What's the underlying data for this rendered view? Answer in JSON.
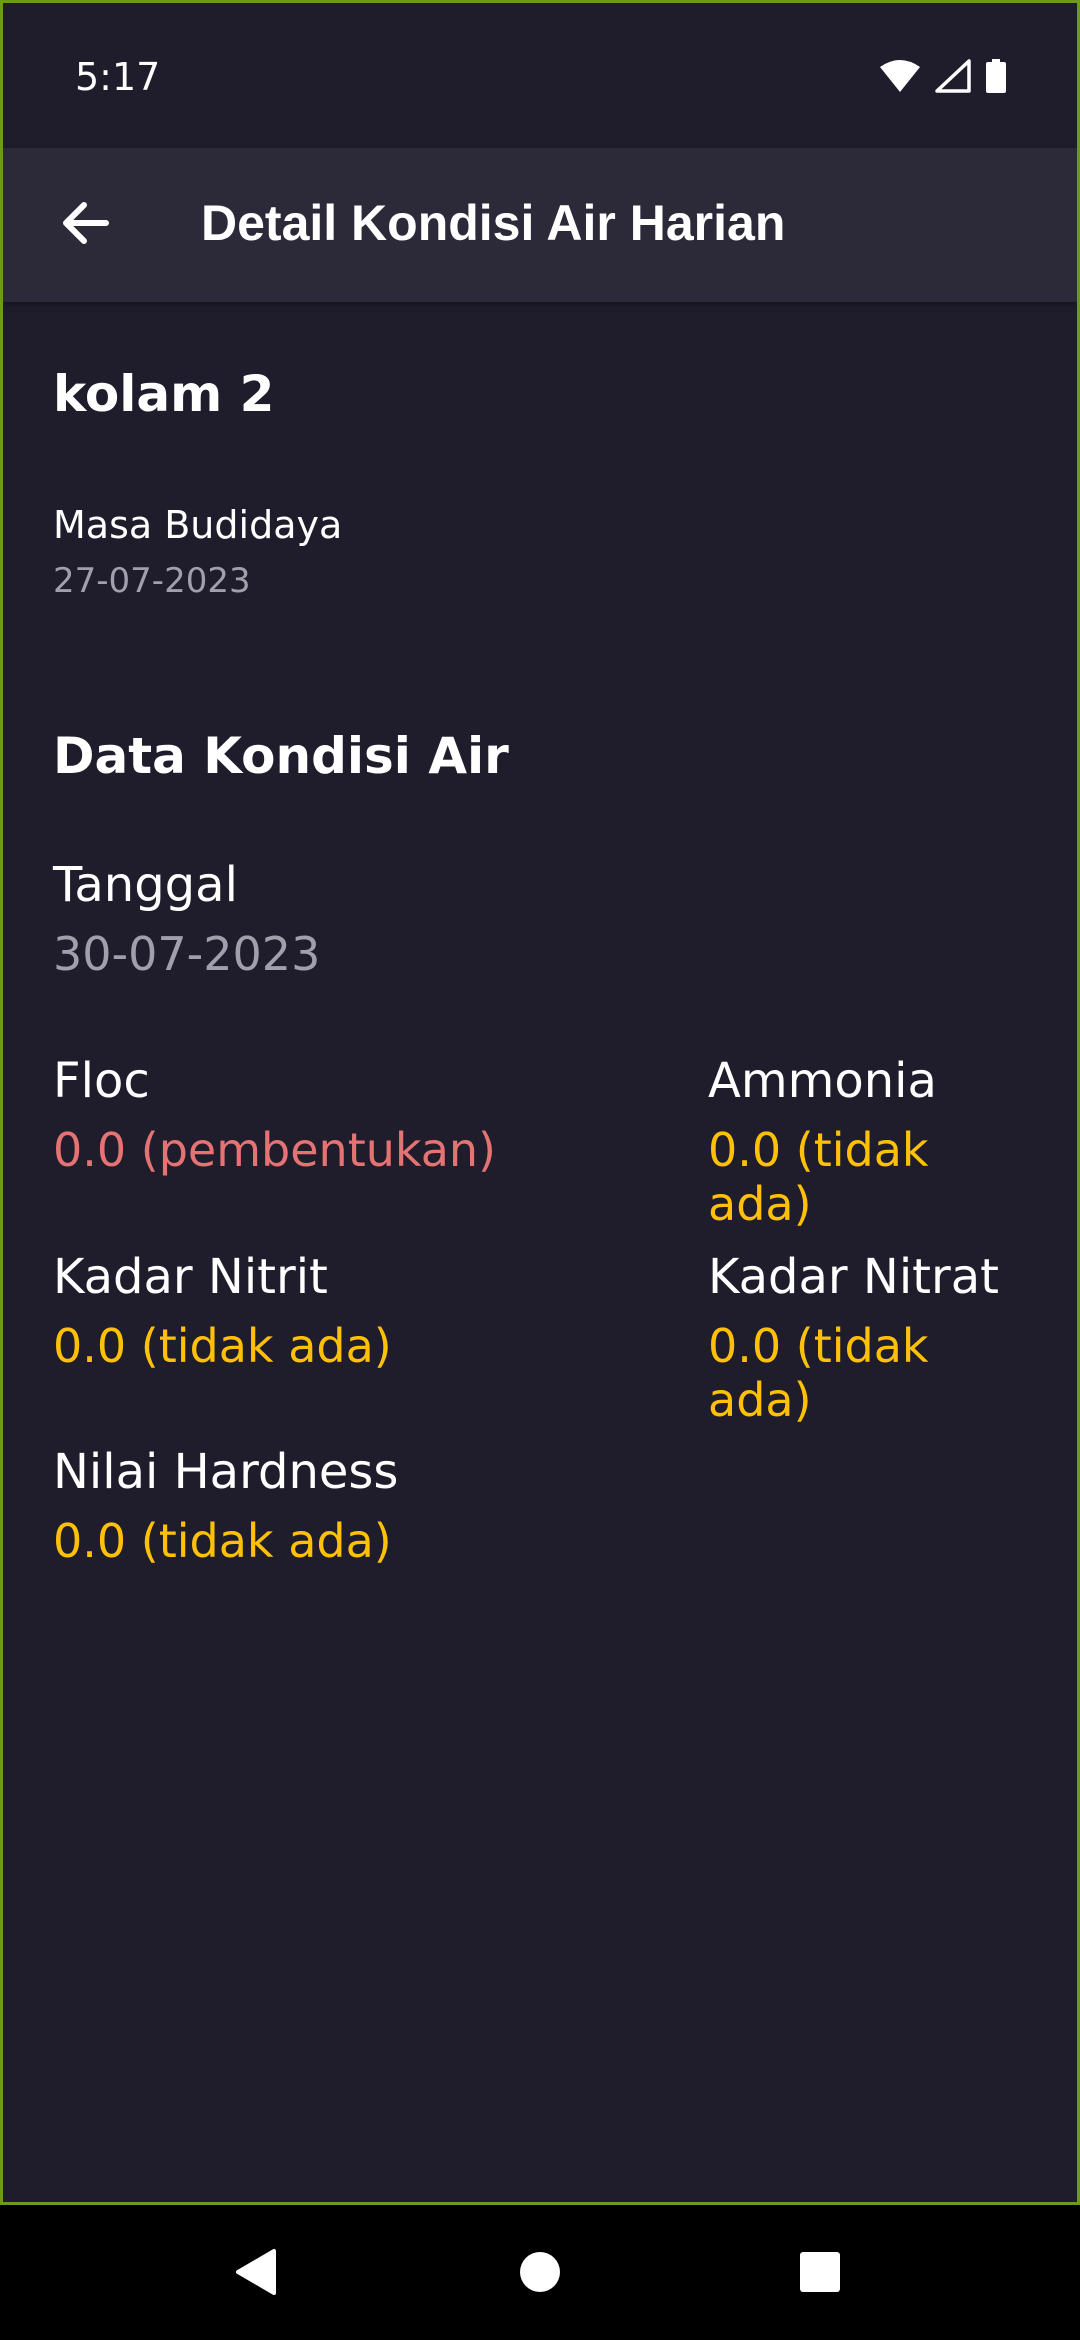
{
  "status_bar": {
    "time": "5:17"
  },
  "app_bar": {
    "title": "Detail Kondisi Air Harian"
  },
  "pond": {
    "name": "kolam 2",
    "period_label": "Masa Budidaya",
    "period_value": "27-07-2023"
  },
  "water": {
    "section_title": "Data Kondisi Air",
    "date_label": "Tanggal",
    "date_value": "30-07-2023",
    "floc_label": "Floc",
    "floc_value": "0.0 (pembentukan)",
    "ammonia_label": "Ammonia",
    "ammonia_value": "0.0 (tidak ada)",
    "nitrite_label": "Kadar Nitrit",
    "nitrite_value": "0.0 (tidak ada)",
    "nitrate_label": "Kadar Nitrat",
    "nitrate_value": "0.0 (tidak ada)",
    "hardness_label": "Nilai Hardness",
    "hardness_value": "0.0 (tidak ada)"
  },
  "colors": {
    "background": "#1f1d2b",
    "app_bar": "#2c2a38",
    "warning_red": "#e57373",
    "warning_amber": "#ffc107",
    "muted_text": "#a19fab"
  },
  "icons": {
    "back": "arrow-left-icon",
    "wifi": "wifi-icon",
    "signal": "cell-signal-icon",
    "battery": "battery-icon",
    "nav_back": "triangle-back-icon",
    "nav_home": "circle-home-icon",
    "nav_recents": "square-recents-icon"
  }
}
